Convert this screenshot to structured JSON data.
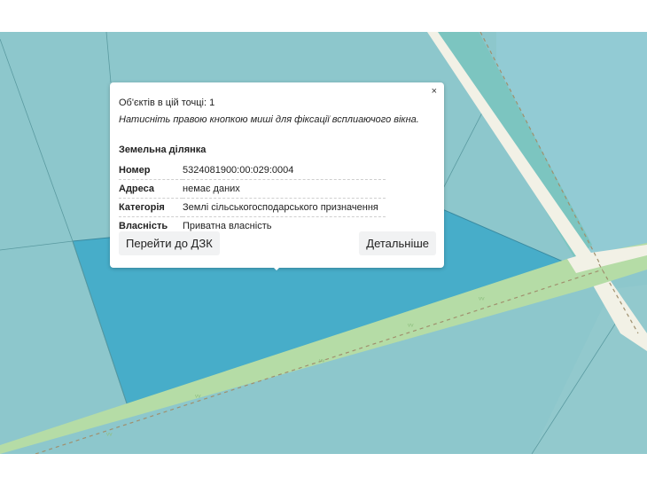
{
  "popup": {
    "close_label": "×",
    "objects_count": "Об'єктів в цій точці: 1",
    "hint": "Натисніть правою кнопкою миші для фіксації всплиаючого вікна.",
    "section_title": "Земельна ділянка",
    "properties": [
      {
        "key": "Номер",
        "value": "5324081900:00:029:0004"
      },
      {
        "key": "Адреса",
        "value": "немає даних"
      },
      {
        "key": "Категорія",
        "value": "Землі сільськогосподарського призначення"
      },
      {
        "key": "Власність",
        "value": "Приватна власність"
      }
    ],
    "go_to_dzk_label": "Перейти до ДЗК",
    "details_label": "Детальніше"
  },
  "map": {
    "colors": {
      "parcel_fill": "#8dc7cc",
      "selected_parcel": "#47adc9",
      "road_green": "#b5dca6",
      "road_white": "#f2f1e6",
      "water_strip": "#7cc5c0",
      "track": "#a0906e"
    },
    "icons": [
      "grass-symbol",
      "dashed-track"
    ]
  }
}
